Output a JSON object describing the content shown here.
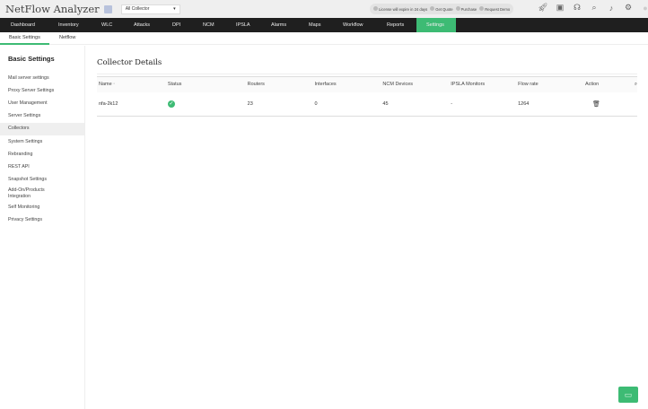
{
  "app": {
    "title": "NetFlow Analyzer",
    "collector_select": "All Collector"
  },
  "license": {
    "text": "License will expire in 24 days",
    "quote": "Get Quote",
    "purchase": "Purchase",
    "demo": "Request Demo"
  },
  "nav": [
    "Dashboard",
    "Inventory",
    "WLC",
    "Attacks",
    "DPI",
    "NCM",
    "IPSLA",
    "Alarms",
    "Maps",
    "Workflow",
    "Reports",
    "Settings"
  ],
  "subnav": [
    "Basic Settings",
    "Netflow"
  ],
  "sidebar": {
    "title": "Basic Settings",
    "items": [
      "Mail server settings",
      "Proxy Server Settings",
      "User Management",
      "Server Settings",
      "Collectors",
      "System Settings",
      "Rebranding",
      "REST API",
      "Snapshot Settings",
      "Add-On/Products Integration",
      "Self Monitoring",
      "Privacy Settings"
    ],
    "active": "Collectors"
  },
  "main": {
    "title": "Collector Details",
    "columns": [
      "Name",
      "Status",
      "Routers",
      "Interfaces",
      "NCM Devices",
      "IPSLA Monitors",
      "Flow rate",
      "Action"
    ],
    "rows": [
      {
        "name": "nfa-2k12",
        "status": "ok",
        "routers": "23",
        "interfaces": "0",
        "ncm": "45",
        "ipsla": "-",
        "flow": "1264"
      }
    ]
  },
  "colors": {
    "accent": "#3dbb74",
    "nav_bg": "#1f1f1f"
  }
}
